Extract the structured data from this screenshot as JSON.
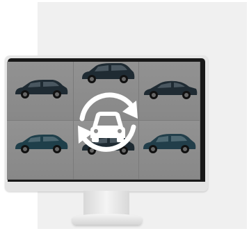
{
  "scene": {
    "monitor_icon": "monitor-icon",
    "overlay_icon": "car-sync-icon",
    "cars": [
      {
        "id": "car-1",
        "icon": "suv-icon",
        "color": "#1f2b33"
      },
      {
        "id": "car-2",
        "icon": "suv-icon",
        "color": "#1f2b33"
      },
      {
        "id": "car-3",
        "icon": "sedan-icon",
        "color": "#1f2b33"
      },
      {
        "id": "car-4",
        "icon": "suv-icon",
        "color": "#1f3f4a"
      },
      {
        "id": "car-5",
        "icon": "suv-icon",
        "color": "#1f2b33"
      },
      {
        "id": "car-6",
        "icon": "suv-icon",
        "color": "#223e4a"
      }
    ],
    "colors": {
      "screen_bg": "#8c8c8c",
      "overlay_white": "#ffffff",
      "bezel": "#181818",
      "frame": "#e6e6e6"
    }
  }
}
